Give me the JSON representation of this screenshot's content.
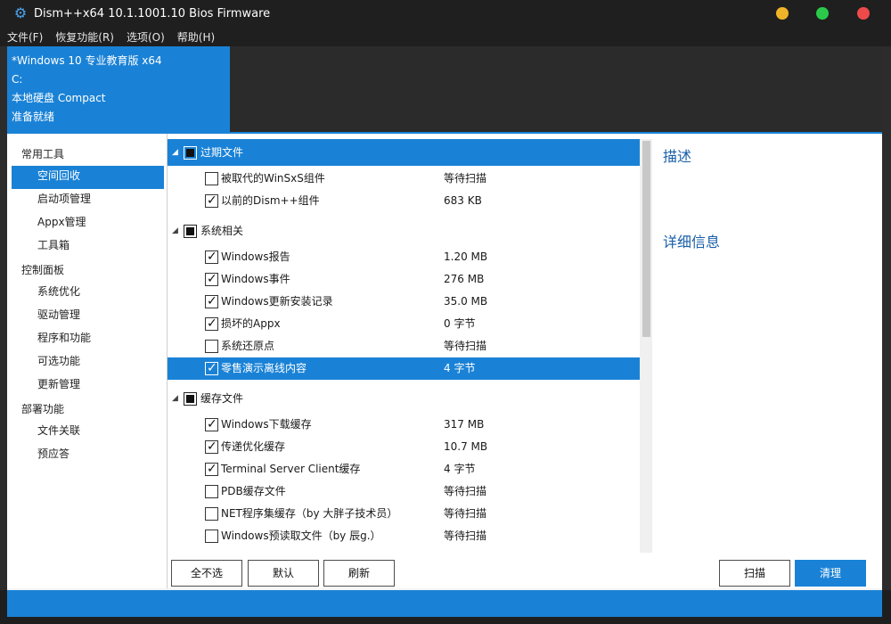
{
  "window": {
    "title": "Dism++x64 10.1.1001.10 Bios Firmware"
  },
  "menu": [
    "文件(F)",
    "恢复功能(R)",
    "选项(O)",
    "帮助(H)"
  ],
  "session": {
    "os": "*Windows 10 专业教育版 x64",
    "drive": "C:",
    "disk": "本地硬盘 Compact",
    "status": "准备就绪"
  },
  "nav": {
    "groups": [
      {
        "label": "常用工具",
        "items": [
          "空间回收",
          "启动项管理",
          "Appx管理",
          "工具箱"
        ]
      },
      {
        "label": "控制面板",
        "items": [
          "系统优化",
          "驱动管理",
          "程序和功能",
          "可选功能",
          "更新管理"
        ]
      },
      {
        "label": "部署功能",
        "items": [
          "文件关联",
          "预应答"
        ]
      }
    ],
    "selected": "空间回收"
  },
  "tree": {
    "categories": [
      {
        "label": "过期文件",
        "highlight": true,
        "items": [
          {
            "label": "被取代的WinSxS组件",
            "size": "等待扫描",
            "checked": false
          },
          {
            "label": "以前的Dism++组件",
            "size": "683 KB",
            "checked": true
          }
        ]
      },
      {
        "label": "系统相关",
        "highlight": false,
        "items": [
          {
            "label": "Windows报告",
            "size": "1.20 MB",
            "checked": true
          },
          {
            "label": "Windows事件",
            "size": "276 MB",
            "checked": true
          },
          {
            "label": "Windows更新安装记录",
            "size": "35.0 MB",
            "checked": true
          },
          {
            "label": "损坏的Appx",
            "size": "0 字节",
            "checked": true
          },
          {
            "label": "系统还原点",
            "size": "等待扫描",
            "checked": false
          },
          {
            "label": "零售演示离线内容",
            "size": "4 字节",
            "checked": true,
            "highlight": true
          }
        ]
      },
      {
        "label": "缓存文件",
        "highlight": false,
        "items": [
          {
            "label": "Windows下载缓存",
            "size": "317 MB",
            "checked": true
          },
          {
            "label": "传递优化缓存",
            "size": "10.7 MB",
            "checked": true
          },
          {
            "label": "Terminal Server Client缓存",
            "size": "4 字节",
            "checked": true
          },
          {
            "label": "PDB缓存文件",
            "size": "等待扫描",
            "checked": false
          },
          {
            "label": "NET程序集缓存（by 大胖子技术员）",
            "size": "等待扫描",
            "checked": false
          },
          {
            "label": "Windows预读取文件（by 辰g.）",
            "size": "等待扫描",
            "checked": false
          }
        ]
      }
    ]
  },
  "description": {
    "heading": "描述",
    "details": "详细信息"
  },
  "buttons": {
    "deselect_all": "全不选",
    "default": "默认",
    "refresh": "刷新",
    "scan": "扫描",
    "clean": "清理"
  },
  "colors": {
    "accent": "#1a82d6",
    "titlebar": "#1f1f1f",
    "minimize": "#f0b428",
    "maximize": "#2ac94a",
    "close": "#ef4a4a"
  }
}
